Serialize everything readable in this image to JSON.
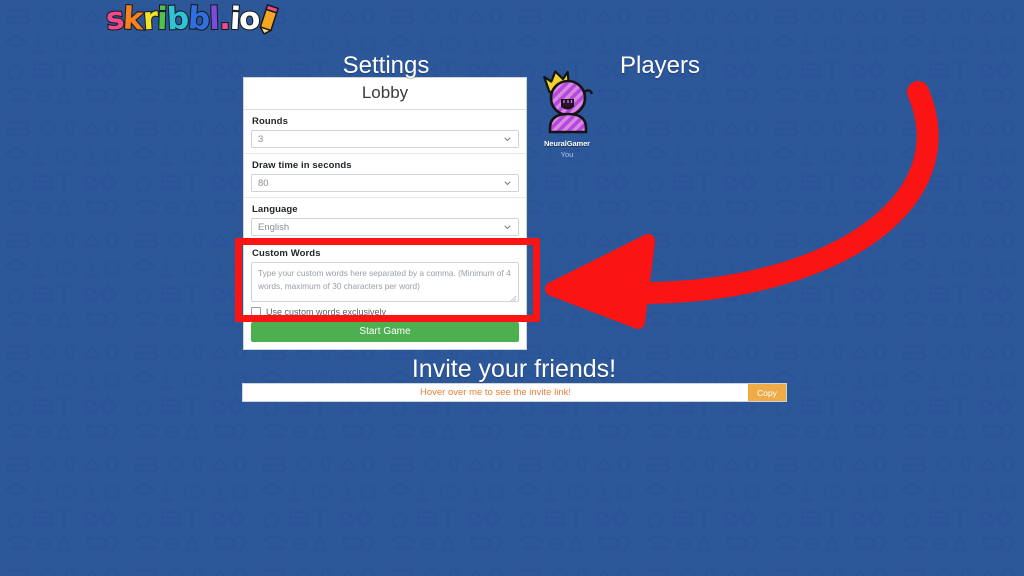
{
  "app": {
    "logo_text": "skribbl.io",
    "logo_letters": [
      "s",
      "k",
      "r",
      "i",
      "b",
      "b",
      "l",
      ".",
      "i",
      "o"
    ],
    "background_color": "#2c5799"
  },
  "headings": {
    "settings": "Settings",
    "players": "Players",
    "invite": "Invite your friends!"
  },
  "settings_panel": {
    "lobby_title": "Lobby",
    "fields": [
      {
        "label": "Rounds",
        "value": "3",
        "icon": "chevron-down-icon"
      },
      {
        "label": "Draw time in seconds",
        "value": "80",
        "icon": "chevron-down-icon"
      },
      {
        "label": "Language",
        "value": "English",
        "icon": "chevron-down-icon"
      }
    ],
    "custom_words": {
      "label": "Custom Words",
      "value": "",
      "placeholder": "Type your custom words here separated by a comma. (Minimum of 4 words, maximum of 30 characters per word)",
      "checkbox_label": "Use custom words exclusively",
      "checkbox_checked": false
    },
    "start_button": {
      "label": "Start Game",
      "color": "#4caf50"
    }
  },
  "players": [
    {
      "name": "NeuralGamer",
      "subtitle": "You",
      "is_host": true,
      "avatar": {
        "body_color": "#b44ad6",
        "stripe_color": "#d98ae8",
        "crown_color": "#f2d22e",
        "outline_color": "#141414"
      }
    }
  ],
  "invite": {
    "link_text": "Hover over me to see the invite link!",
    "link_text_color": "#e8813a",
    "copy_label": "Copy",
    "copy_color": "#eeab48"
  },
  "annotations": {
    "highlight_color": "#fb1414",
    "arrow_color": "#fb1414",
    "highlight_target": "custom-words-section",
    "arrow_direction": "curved-right-to-left"
  }
}
